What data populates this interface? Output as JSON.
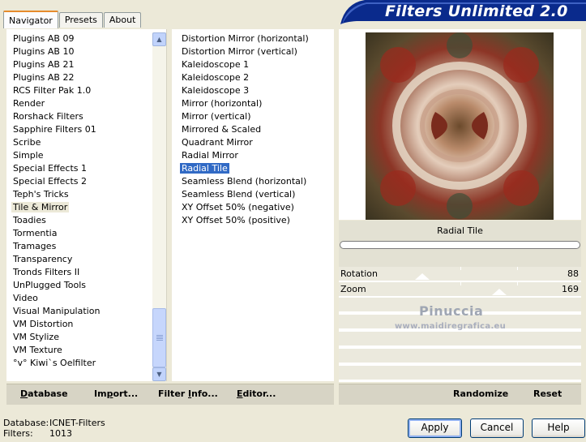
{
  "app": {
    "title": "Filters Unlimited 2.0"
  },
  "tabs": [
    {
      "label": "Navigator",
      "active": true
    },
    {
      "label": "Presets"
    },
    {
      "label": "About"
    }
  ],
  "categories": {
    "items": [
      "Plugins AB 09",
      "Plugins AB 10",
      "Plugins AB 21",
      "Plugins AB 22",
      "RCS Filter Pak 1.0",
      "Render",
      "Rorshack Filters",
      "Sapphire Filters 01",
      "Scribe",
      "Simple",
      "Special Effects 1",
      "Special Effects 2",
      "Teph's Tricks",
      "Tile & Mirror",
      "Toadies",
      "Tormentia",
      "Tramages",
      "Transparency",
      "Tronds Filters II",
      "UnPlugged Tools",
      "Video",
      "Visual Manipulation",
      "VM Distortion",
      "VM Stylize",
      "VM Texture",
      "°v° Kiwi`s Oelfilter"
    ],
    "selected": "Tile & Mirror"
  },
  "filters": {
    "items": [
      "Distortion Mirror (horizontal)",
      "Distortion Mirror (vertical)",
      "Kaleidoscope 1",
      "Kaleidoscope 2",
      "Kaleidoscope 3",
      "Mirror (horizontal)",
      "Mirror (vertical)",
      "Mirrored & Scaled",
      "Quadrant Mirror",
      "Radial Mirror",
      "Radial Tile",
      "Seamless Blend (horizontal)",
      "Seamless Blend (vertical)",
      "XY Offset 50% (negative)",
      "XY Offset 50% (positive)"
    ],
    "selected": "Radial Tile"
  },
  "preview": {
    "filter_name": "Radial Tile",
    "progress": 0
  },
  "sliders": [
    {
      "label": "Rotation",
      "value": "88"
    },
    {
      "label": "Zoom",
      "value": "169"
    }
  ],
  "watermark": {
    "name": "Pinuccia",
    "site": "www.maidiregrafica.eu"
  },
  "bottom_bar": {
    "database": {
      "first": "D",
      "rest": "atabase"
    },
    "import": {
      "before": "Im",
      "u": "p",
      "after": "ort..."
    },
    "filter_info": {
      "before": "Filter ",
      "u": "I",
      "after": "nfo..."
    },
    "editor": {
      "first": "E",
      "rest": "ditor..."
    },
    "randomize": "Randomize",
    "reset": "Reset"
  },
  "status": {
    "database_label": "Database:",
    "database_value": "ICNET-Filters",
    "filters_label": "Filters:",
    "filters_value": "1013"
  },
  "buttons": {
    "apply": "Apply",
    "cancel": "Cancel",
    "help": "Help"
  },
  "colors": {
    "selection": "#316ac5",
    "banner": "#0a2a8c",
    "tab_accent": "#e68b2c"
  }
}
